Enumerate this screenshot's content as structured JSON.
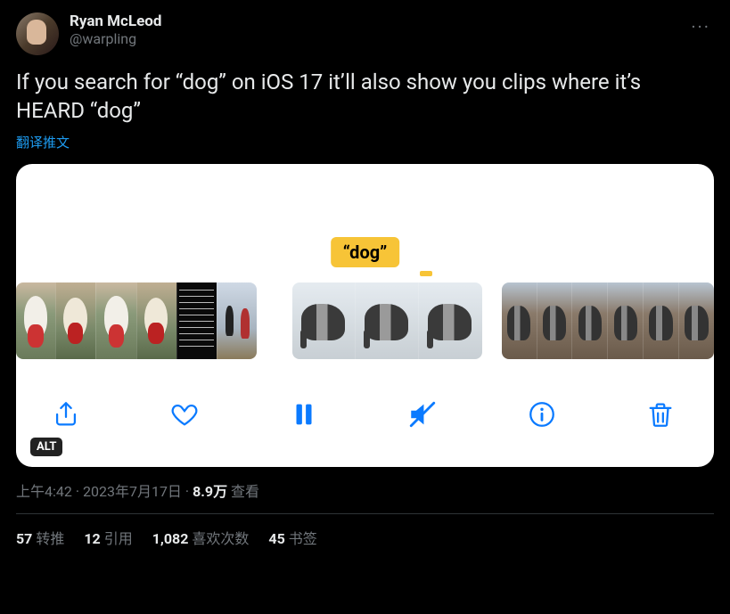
{
  "author": {
    "display_name": "Ryan McLeod",
    "handle": "@warpling"
  },
  "more_label": "···",
  "tweet_text": "If you search for “dog” on iOS 17 it’ll also show you clips where it’s HEARD “dog”",
  "translate_label": "翻译推文",
  "media": {
    "caption_text": "“dog”",
    "alt_badge": "ALT",
    "toolbar": {
      "share": "share-icon",
      "like": "heart-icon",
      "pause": "pause-icon",
      "mute": "mute-icon",
      "info": "info-icon",
      "trash": "trash-icon"
    }
  },
  "meta": {
    "time": "上午4:42",
    "sep1": " · ",
    "date": "2023年7月17日",
    "sep2": " · ",
    "views_count": "8.9万",
    "views_label": " 查看"
  },
  "stats": {
    "retweets": {
      "count": "57",
      "label": "转推"
    },
    "quotes": {
      "count": "12",
      "label": "引用"
    },
    "likes": {
      "count": "1,082",
      "label": "喜欢次数"
    },
    "bookmarks": {
      "count": "45",
      "label": "书签"
    }
  }
}
